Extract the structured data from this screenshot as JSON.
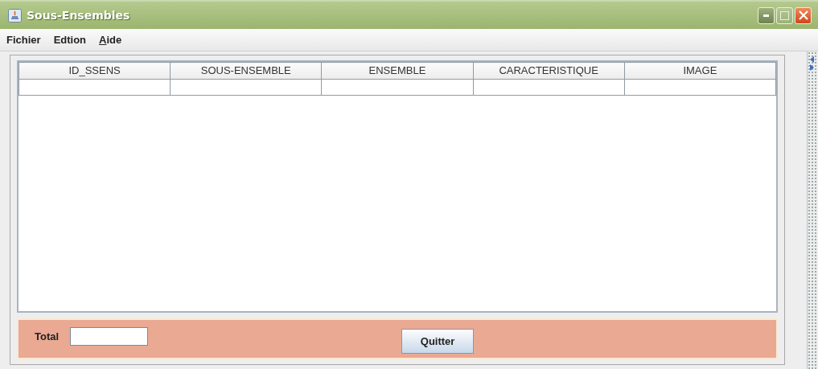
{
  "window": {
    "title": "Sous-Ensembles"
  },
  "menu": [
    {
      "label": "Fichier"
    },
    {
      "label": "Edtion"
    },
    {
      "label": "Aide",
      "mnemonic_underlined": true
    }
  ],
  "table": {
    "columns": [
      "ID_SSENS",
      "SOUS-ENSEMBLE",
      "ENSEMBLE",
      "CARACTERISTIQUE",
      "IMAGE"
    ]
  },
  "footer": {
    "total_label": "Total",
    "button": "Quitter"
  }
}
